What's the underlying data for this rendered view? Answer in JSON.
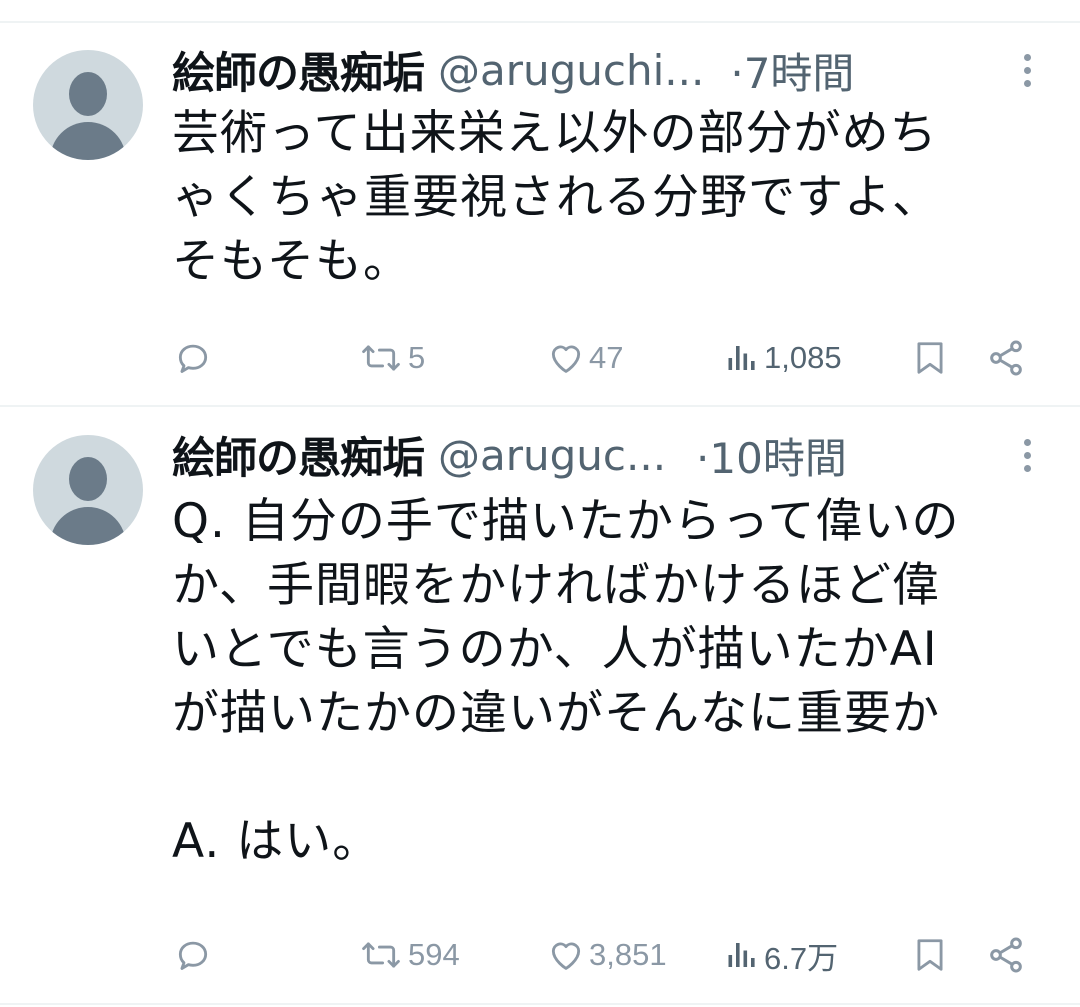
{
  "tweets": [
    {
      "name": "絵師の愚痴垢",
      "handle": "@aruguchi...",
      "time": "·7時間",
      "text": "芸術って出来栄え以外の部分がめち\nゃくちゃ重要視される分野ですよ、\nそもそも。",
      "retweets": "5",
      "likes": "47",
      "views": "1,085"
    },
    {
      "name": "絵師の愚痴垢",
      "handle": "@aruguc...",
      "time": "·10時間",
      "text": "Q. 自分の手で描いたからって偉いの\nか、手間暇をかければかけるほど偉\nいとでも言うのか、人が描いたかAI\nが描いたかの違いがそんなに重要か\n\nA. はい。",
      "retweets": "594",
      "likes": "3,851",
      "views": "6.7万"
    }
  ],
  "icons": {
    "reply": "reply-icon",
    "retweet": "retweet-icon",
    "like": "heart-icon",
    "views": "views-icon",
    "bookmark": "bookmark-icon",
    "share": "share-icon",
    "more": "more-icon"
  },
  "colors": {
    "text": "#0f1419",
    "secondary": "#536471",
    "icon": "#8b98a5",
    "divider": "#eff3f4",
    "avatar_bg": "#cfd9de"
  }
}
